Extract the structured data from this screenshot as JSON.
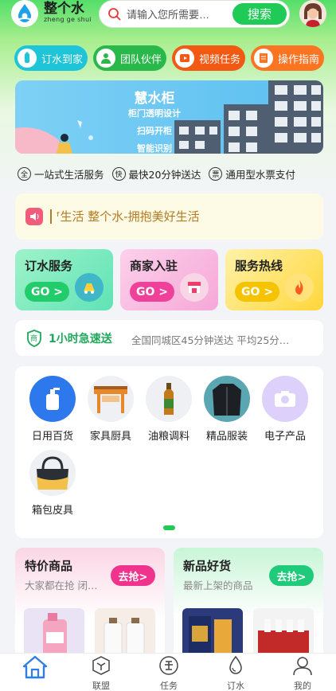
{
  "header": {
    "brand_cn": "整个水",
    "brand_en": "zheng ge shui",
    "search_placeholder": "请输入您所需要…",
    "search_button": "搜索"
  },
  "quick_nav": [
    {
      "label": "订水到家",
      "icon": "water-delivery-icon",
      "color": "#1ec4d8"
    },
    {
      "label": "团队伙伴",
      "icon": "team-icon",
      "color": "#2bb84a"
    },
    {
      "label": "视频任务",
      "icon": "video-icon",
      "color": "#f25a14"
    },
    {
      "label": "操作指南",
      "icon": "guide-icon",
      "color": "#fb7422"
    }
  ],
  "banner": {
    "title": "慧水柜",
    "lines": [
      "柜门透明设计",
      "扫码开柜",
      "智能识别"
    ]
  },
  "features": [
    {
      "badge": "全",
      "text": "一站式生活服务"
    },
    {
      "badge": "快",
      "text": "最快20分钟送达"
    },
    {
      "badge": "票",
      "text": "通用型水票支付"
    }
  ],
  "notice": {
    "text": "ᶠ生活    整个水-拥抱美好生活"
  },
  "service_cards": [
    {
      "title": "订水服务",
      "go": "GO >",
      "icon": "water-service-icon"
    },
    {
      "title": "商家入驻",
      "go": "GO >",
      "icon": "shop-icon"
    },
    {
      "title": "服务热线",
      "go": "GO >",
      "icon": "hotline-icon"
    }
  ],
  "urgent": {
    "badge": "商",
    "title": "1小时急速送",
    "desc": "全国同城区45分钟送达 平均25分…"
  },
  "categories": [
    {
      "label": "日用百货",
      "icon": "daily-goods-icon"
    },
    {
      "label": "家具厨具",
      "icon": "furniture-icon"
    },
    {
      "label": "油粮调料",
      "icon": "oil-grain-icon"
    },
    {
      "label": "精品服装",
      "icon": "clothing-icon"
    },
    {
      "label": "电子产品",
      "icon": "electronics-icon"
    },
    {
      "label": "箱包皮具",
      "icon": "bags-icon"
    }
  ],
  "products": [
    {
      "title": "特价商品",
      "sub": "大家都在抢 闭…",
      "button": "去抢>"
    },
    {
      "title": "新品好货",
      "sub": "最新上架的商品",
      "button": "去抢>"
    }
  ],
  "tabbar": [
    {
      "label": "首页",
      "icon": "home-icon",
      "active": true
    },
    {
      "label": "联盟",
      "icon": "alliance-icon"
    },
    {
      "label": "任务",
      "icon": "task-icon"
    },
    {
      "label": "订水",
      "icon": "water-drop-icon"
    },
    {
      "label": "我的",
      "icon": "user-icon"
    }
  ],
  "colors": {
    "accent": "#1fca56",
    "notice_text": "#b37b22"
  }
}
